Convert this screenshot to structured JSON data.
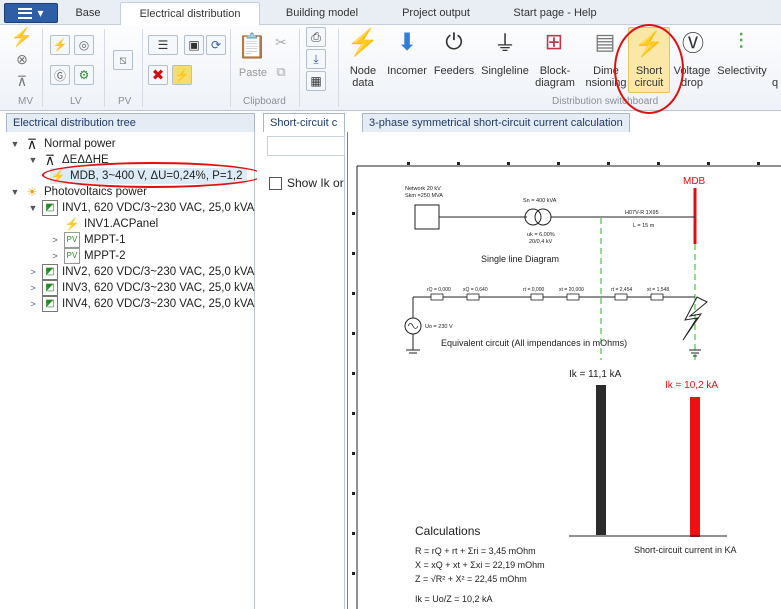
{
  "app_menu_label": "▾",
  "tabs": [
    "Base",
    "Electrical distribution",
    "Building model",
    "Project output",
    "Start page - Help"
  ],
  "active_tab": "Electrical distribution",
  "ribbon": {
    "groups": {
      "mv": "MV",
      "lv": "LV",
      "pv": "PV",
      "clipboard": "Clipboard",
      "distribution": "Distribution switchboard"
    },
    "paste_label": "Paste",
    "buttons": [
      {
        "label1": "Node",
        "label2": "data"
      },
      {
        "label1": "Incomer",
        "label2": ""
      },
      {
        "label1": "Feeders",
        "label2": ""
      },
      {
        "label1": "Singleline",
        "label2": ""
      },
      {
        "label1": "Block-",
        "label2": "diagram"
      },
      {
        "label1": "Dime",
        "label2": "nsioning"
      },
      {
        "label1": "Short",
        "label2": "circuit"
      },
      {
        "label1": "Voltage",
        "label2": "drop"
      },
      {
        "label1": "Selectivity",
        "label2": ""
      },
      {
        "label1": "",
        "label2": "q"
      }
    ]
  },
  "panels": {
    "tree_tab": "Electrical distribution tree",
    "sc_tab": "Short-circuit c",
    "calc_tab": "3-phase symmetrical short-circuit current calculation",
    "show_ik": "Show Ik or"
  },
  "tree": [
    {
      "text": "Normal power",
      "level": 0,
      "expander": "▼",
      "icon": "tower-icon"
    },
    {
      "text": "ΔΕΔΔΗΕ",
      "level": 1,
      "expander": "▼",
      "icon": "tower-icon"
    },
    {
      "text": "MDB, 3~400 V, ΔU=0,24%, P=1,2",
      "level": 2,
      "expander": "",
      "icon": "bolt-icon"
    },
    {
      "text": "Photovoltaics power",
      "level": 0,
      "expander": "▼",
      "icon": "sun-icon"
    },
    {
      "text": "INV1, 620 VDC/3~230 VAC, 25,0 kVA,",
      "level": 1,
      "expander": "▼",
      "icon": "inverter-icon"
    },
    {
      "text": "INV1.ACPanel",
      "level": 2,
      "expander": "",
      "icon": "bolt-icon"
    },
    {
      "text": "MPPT-1",
      "level": 2,
      "expander": ">",
      "icon": "pv-icon"
    },
    {
      "text": "MPPT-2",
      "level": 2,
      "expander": ">",
      "icon": "pv-icon"
    },
    {
      "text": "INV2, 620 VDC/3~230 VAC, 25,0 kVA,",
      "level": 1,
      "expander": ">",
      "icon": "inverter-icon"
    },
    {
      "text": "INV3, 620 VDC/3~230 VAC, 25,0 kVA,",
      "level": 1,
      "expander": ">",
      "icon": "inverter-icon"
    },
    {
      "text": "INV4, 620 VDC/3~230 VAC, 25,0 kVA,",
      "level": 1,
      "expander": ">",
      "icon": "inverter-icon"
    }
  ],
  "diagram": {
    "mdb": "MDB",
    "network1": "Network  20 kV",
    "network2": "Skm =250 MVA",
    "trafo1": "Sn = 400 kVA",
    "trafo2": "uk = 6,00%",
    "trafo3": "20/0,4 kV",
    "cable1": "H07V-R 1X95",
    "cable2": "L = 15 m",
    "sld": "Single line Diagram",
    "imp": [
      "rQ = 0,000",
      "xQ = 0,640",
      "rt = 0,000",
      "xt = 20,000",
      "rt = 2,454",
      "xt = 1,548"
    ],
    "uo": "Uo = 230 V",
    "eq": "Equivalent circuit (All impendances in mOhms)",
    "ik1": "Ik = 11,1 kA",
    "ik2": "Ik = 10,2 kA",
    "calc_title": "Calculations",
    "calc_r": "R = rQ + rt + Σri =   3,45 mOhm",
    "calc_x": "X = xQ + xt + Σxi =  22,19 mOhm",
    "calc_z": "Z = √R² + X²  =  22,45 mOhm",
    "calc_ik": "Ik = Uo/Z =   10,2 kA",
    "sc_label": "Short-circuit current in KA"
  },
  "colors": {
    "accent": "#2f5ea8",
    "highlight_oval": "#e01010",
    "bar_red": "#ee1111",
    "bar_black": "#2b2b2b",
    "dash_green": "#44cc44"
  }
}
